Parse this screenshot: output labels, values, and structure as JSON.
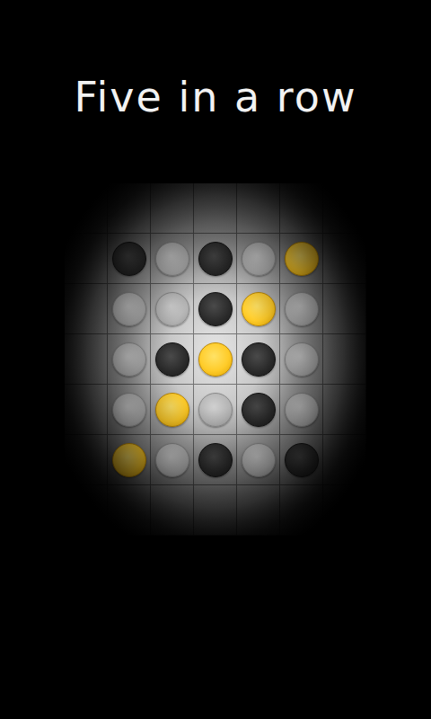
{
  "title": "Five in a row",
  "board": {
    "rows": [
      [
        {
          "kind": "black"
        },
        {
          "kind": "empty"
        },
        {
          "kind": "black"
        },
        {
          "kind": "empty"
        },
        {
          "kind": "yellow"
        }
      ],
      [
        {
          "kind": "empty"
        },
        {
          "kind": "empty"
        },
        {
          "kind": "black"
        },
        {
          "kind": "yellow"
        },
        {
          "kind": "empty"
        }
      ],
      [
        {
          "kind": "empty"
        },
        {
          "kind": "black"
        },
        {
          "kind": "yellow"
        },
        {
          "kind": "black"
        },
        {
          "kind": "empty"
        }
      ],
      [
        {
          "kind": "empty"
        },
        {
          "kind": "yellow"
        },
        {
          "kind": "empty"
        },
        {
          "kind": "black"
        },
        {
          "kind": "empty"
        }
      ],
      [
        {
          "kind": "yellow"
        },
        {
          "kind": "empty"
        },
        {
          "kind": "black"
        },
        {
          "kind": "empty"
        },
        {
          "kind": "black"
        }
      ]
    ]
  }
}
